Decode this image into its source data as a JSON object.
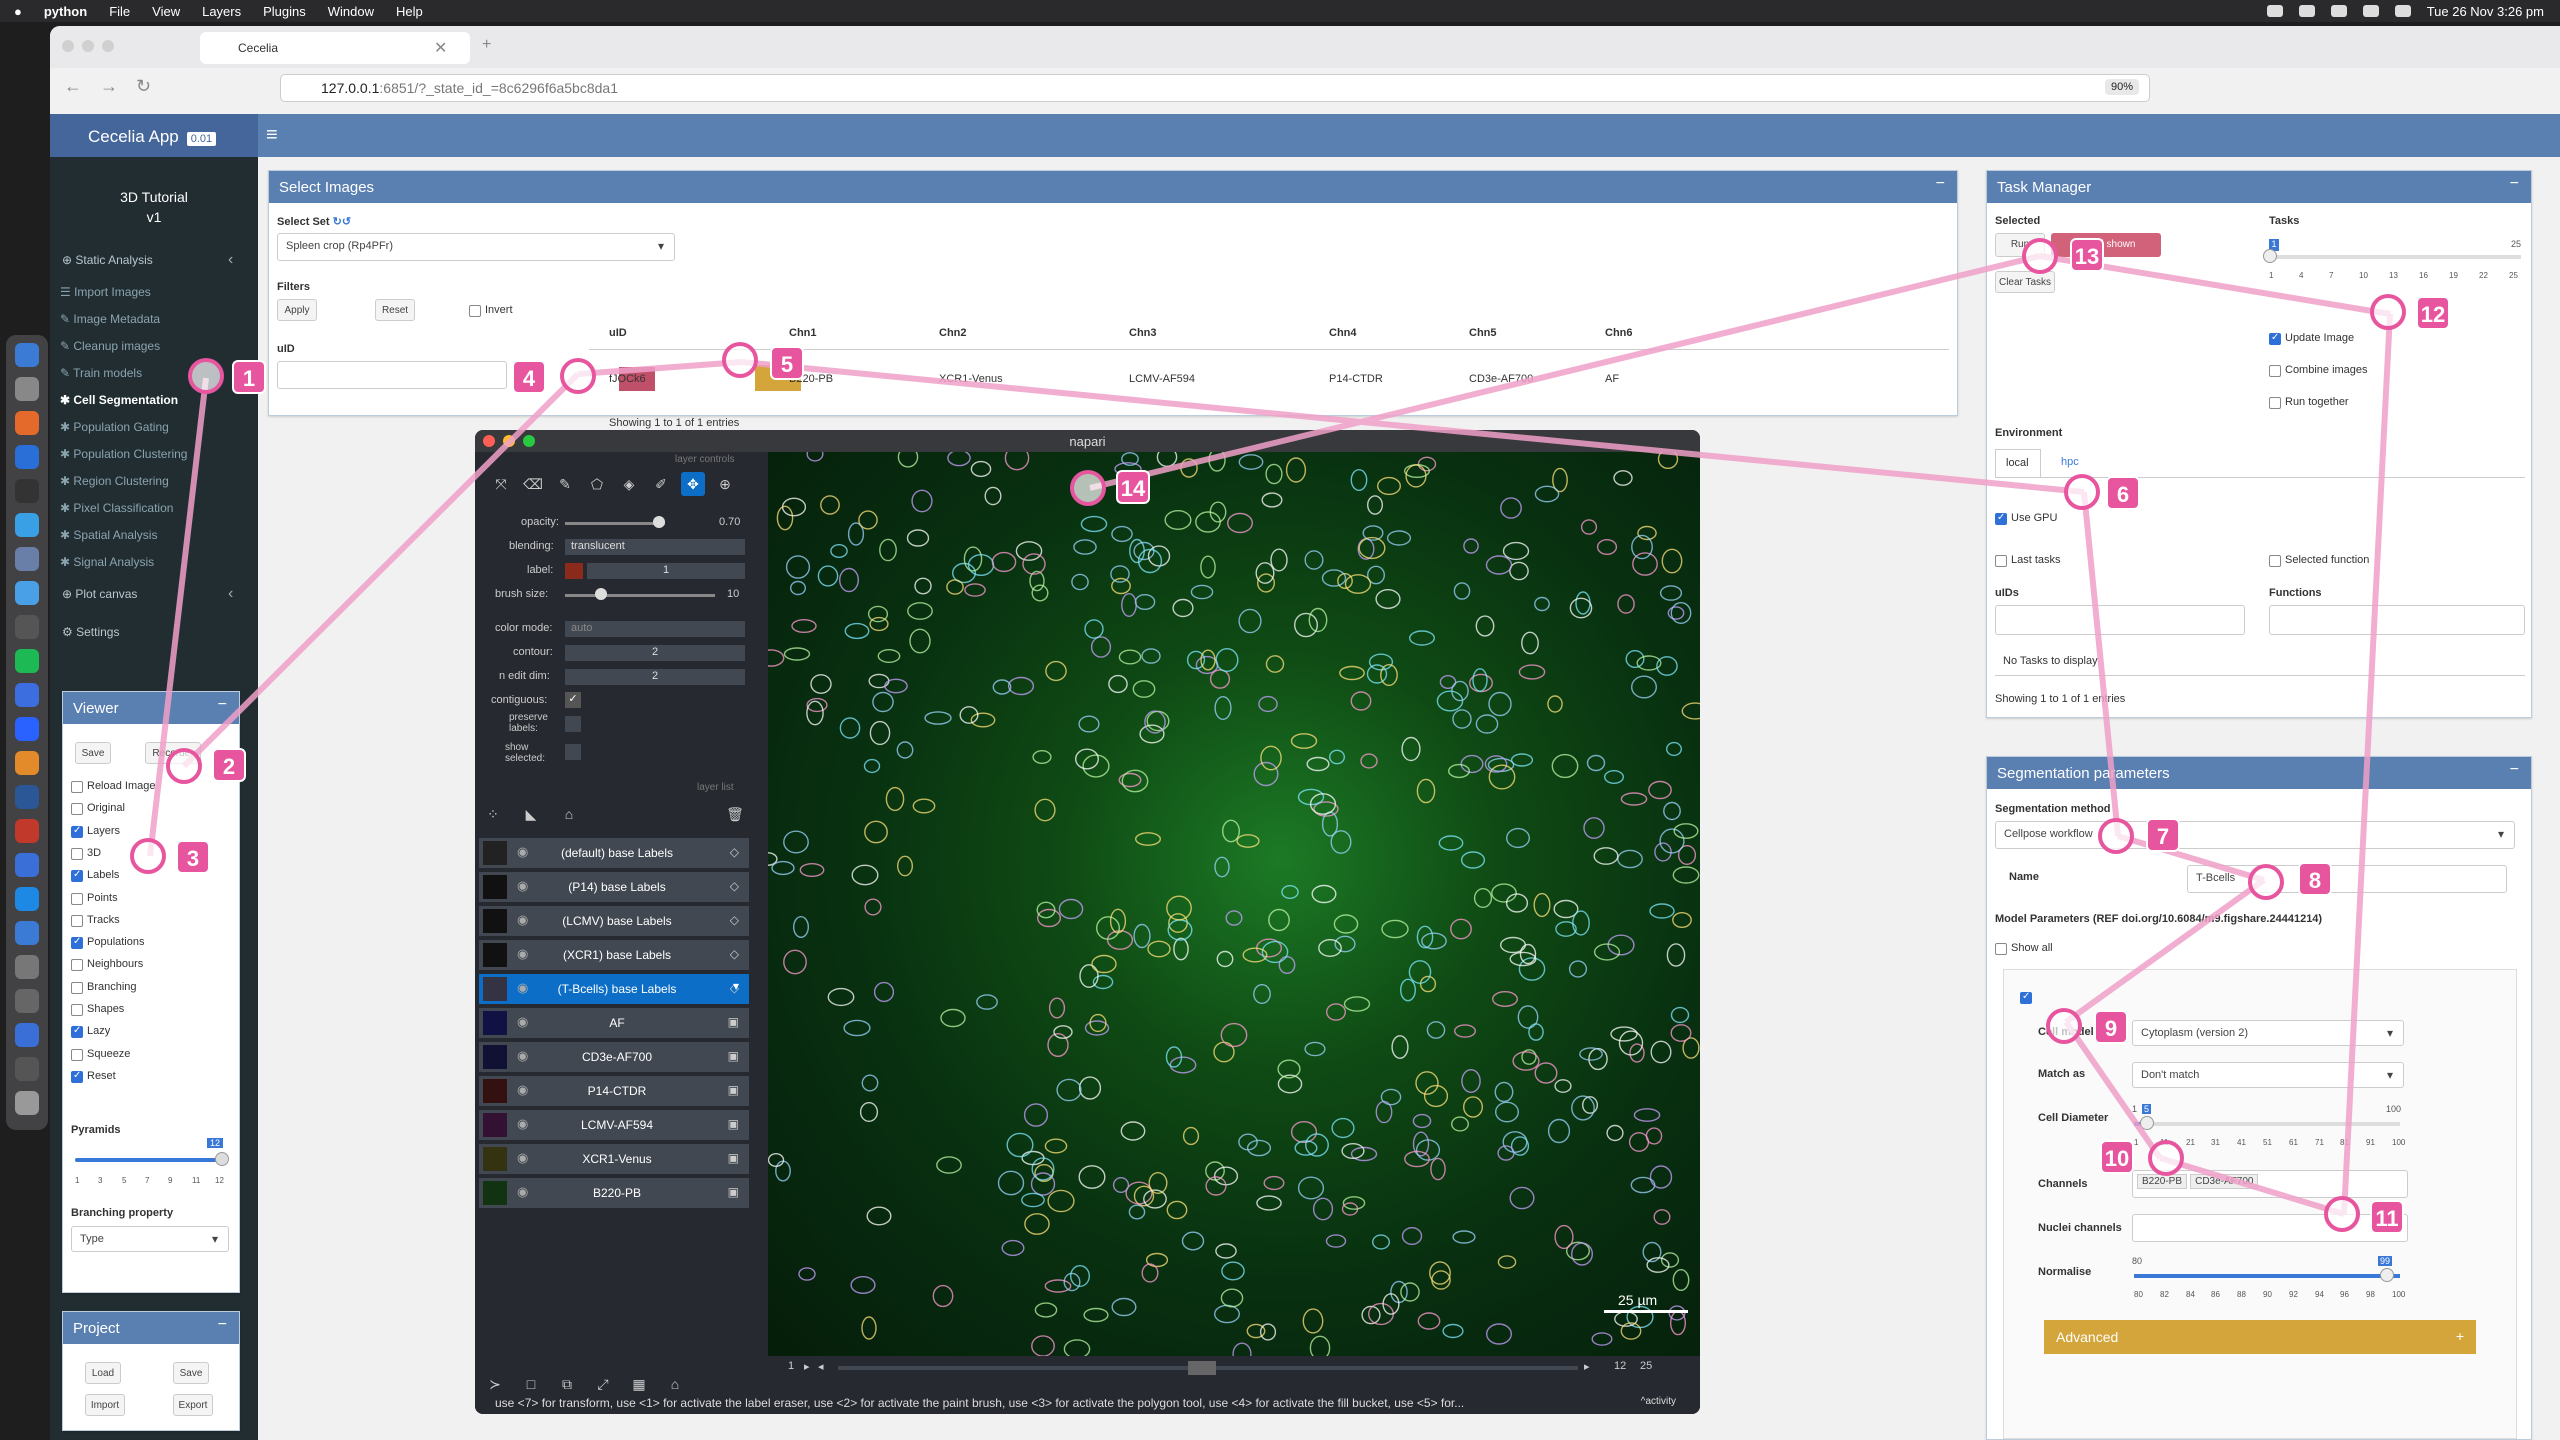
{
  "menubar": {
    "app": "python",
    "items": [
      "File",
      "View",
      "Layers",
      "Plugins",
      "Window",
      "Help"
    ],
    "datetime": "Tue 26 Nov  3:26 pm"
  },
  "browser": {
    "tab_title": "Cecelia",
    "url_host": "127.0.0.1",
    "url_rest": ":6851/?_state_id_=8c6296f6a5bc8da1",
    "zoom": "90%"
  },
  "app": {
    "brand": "Cecelia App",
    "version": "0.01",
    "project_title": "3D Tutorial",
    "project_version": "v1"
  },
  "sidebar": {
    "section": "Static Analysis",
    "items": [
      "Import Images",
      "Image Metadata",
      "Cleanup images",
      "Train models",
      "Cell Segmentation",
      "Population Gating",
      "Population Clustering",
      "Region Clustering",
      "Pixel Classification",
      "Spatial Analysis",
      "Signal Analysis"
    ],
    "plot": "Plot canvas",
    "settings": "Settings"
  },
  "viewer": {
    "title": "Viewer",
    "save": "Save",
    "recorder": "Recorder",
    "options": [
      {
        "label": "Reload Image",
        "on": false
      },
      {
        "label": "Original",
        "on": false
      },
      {
        "label": "Layers",
        "on": true
      },
      {
        "label": "3D",
        "on": false
      },
      {
        "label": "Labels",
        "on": true
      },
      {
        "label": "Points",
        "on": false
      },
      {
        "label": "Tracks",
        "on": false
      },
      {
        "label": "Populations",
        "on": true
      },
      {
        "label": "Neighbours",
        "on": false
      },
      {
        "label": "Branching",
        "on": false
      },
      {
        "label": "Shapes",
        "on": false
      },
      {
        "label": "Lazy",
        "on": true
      },
      {
        "label": "Squeeze",
        "on": false
      },
      {
        "label": "Reset",
        "on": true
      }
    ],
    "pyramids": "Pyramids",
    "pyr_value": "12",
    "pyr_ticks": [
      "1",
      "3",
      "5",
      "7",
      "9",
      "11",
      "12"
    ],
    "branching": "Branching property",
    "branching_value": "Type"
  },
  "project": {
    "title": "Project",
    "load": "Load",
    "save": "Save",
    "import": "Import",
    "export": "Export"
  },
  "select_images": {
    "title": "Select Images",
    "set_label": "Select Set",
    "set_value": "Spleen crop (Rp4PFr)",
    "filters": "Filters",
    "apply": "Apply",
    "reset": "Reset",
    "invert": "Invert",
    "uid_label": "uID",
    "columns": [
      "uID",
      "Chn1",
      "Chn2",
      "Chn3",
      "Chn4",
      "Chn5",
      "Chn6"
    ],
    "row": [
      "fJOCk6",
      "B220-PB",
      "XCR1-Venus",
      "LCMV-AF594",
      "P14-CTDR",
      "CD3e-AF700",
      "AF"
    ],
    "showing": "Showing 1 to 1 of 1 entries"
  },
  "task_manager": {
    "title": "Task Manager",
    "selected": "Selected",
    "run": "Run",
    "model_shown": "Model shown",
    "tasks": "Tasks",
    "tasks_value": "1",
    "tasks_max": "25",
    "tick_labels": [
      "1",
      "4",
      "7",
      "10",
      "13",
      "16",
      "19",
      "22",
      "25"
    ],
    "clear": "Clear Tasks",
    "update_image": "Update Image",
    "combine_images": "Combine images",
    "run_together": "Run together",
    "environment": "Environment",
    "env_tabs": [
      "local",
      "hpc"
    ],
    "use_gpu": "Use GPU",
    "last_tasks": "Last tasks",
    "selected_function": "Selected function",
    "uids": "uIDs",
    "functions": "Functions",
    "no_tasks": "No Tasks to display",
    "showing": "Showing 1 to 1 of 1 entries"
  },
  "segmentation": {
    "title": "Segmentation parameters",
    "method_label": "Segmentation method",
    "method": "Cellpose workflow",
    "name_label": "Name",
    "name": "T-Bcells",
    "model_params": "Model Parameters (REF doi.org/10.6084/m9.figshare.24441214)",
    "show_all": "Show all",
    "cell_model": "Cell model",
    "cell_model_value": "Cytoplasm (version 2)",
    "match_as": "Match as",
    "match_value": "Don't match",
    "cell_diameter": "Cell Diameter",
    "diam_value": "5",
    "diam_min": "1",
    "diam_max": "100",
    "diam_ticks": [
      "1",
      "11",
      "21",
      "31",
      "41",
      "51",
      "61",
      "71",
      "81",
      "91",
      "100"
    ],
    "channels": "Channels",
    "channels_value": [
      "B220-PB",
      "CD3e-AF700"
    ],
    "nuclei": "Nuclei channels",
    "normalise": "Normalise",
    "norm_min": "80",
    "norm_max": "99",
    "norm_ticks": [
      "80",
      "82",
      "84",
      "86",
      "88",
      "90",
      "92",
      "94",
      "96",
      "98",
      "100"
    ],
    "advanced": "Advanced"
  },
  "napari": {
    "title": "napari",
    "layer_controls": "layer controls",
    "opacity": "opacity:",
    "opacity_value": "0.70",
    "blending": "blending:",
    "blending_value": "translucent",
    "label": "label:",
    "label_value": "1",
    "brush": "brush size:",
    "brush_value": "10",
    "color_mode": "color mode:",
    "color_mode_value": "auto",
    "contour": "contour:",
    "contour_value": "2",
    "n_edit": "n edit dim:",
    "n_edit_value": "2",
    "contiguous": "contiguous:",
    "preserve": "preserve labels:",
    "show_selected": "show selected:",
    "layer_list": "layer list",
    "layers": [
      "(default) base Labels",
      "(P14) base Labels",
      "(LCMV) base Labels",
      "(XCR1) base Labels",
      "(T-Bcells) base Labels",
      "AF",
      "CD3e-AF700",
      "P14-CTDR",
      "LCMV-AF594",
      "XCR1-Venus",
      "B220-PB"
    ],
    "scalebar": "25 µm",
    "frame": "1",
    "frame_a": "12",
    "frame_b": "25",
    "status": "use <7> for transform, use <1> for activate the label eraser, use <2> for activate the paint brush, use <3> for activate the polygon tool, use <4> for activate the fill bucket, use <5> for...",
    "activity": "activity"
  },
  "annotations": [
    "1",
    "2",
    "3",
    "4",
    "5",
    "6",
    "7",
    "8",
    "9",
    "10",
    "11",
    "12",
    "13",
    "14"
  ],
  "colors": {
    "accent": "#5a7fb1",
    "sidebar": "#222d32",
    "pink": "#e8559f",
    "gold": "#d4a53a"
  }
}
